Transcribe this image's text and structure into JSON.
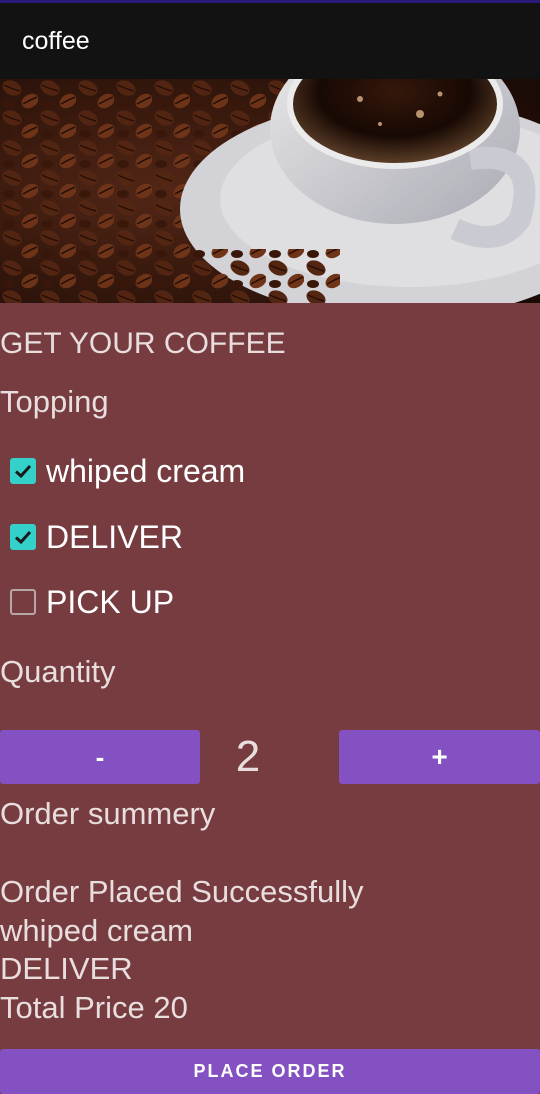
{
  "app_bar": {
    "title": "coffee"
  },
  "main": {
    "heading": "GET YOUR COFFEE",
    "topping_label": "Topping",
    "options": [
      {
        "label": "whiped cream",
        "checked": true
      },
      {
        "label": "DELIVER",
        "checked": true
      },
      {
        "label": "PICK UP",
        "checked": false
      }
    ],
    "quantity_label": "Quantity",
    "quantity": {
      "decrement_label": "-",
      "value": "2",
      "increment_label": "+"
    },
    "order_summary_label": "Order summery",
    "summary_lines": [
      "Order Placed Successfully",
      "whiped cream",
      "DELIVER",
      "Total Price 20"
    ],
    "place_order_label": "PLACE  ORDER"
  },
  "colors": {
    "background": "#763c40",
    "app_bar": "#121212",
    "button": "#8451c3",
    "checkbox_accent": "#33d1c9"
  },
  "icons": {
    "check": "checkmark-icon"
  }
}
